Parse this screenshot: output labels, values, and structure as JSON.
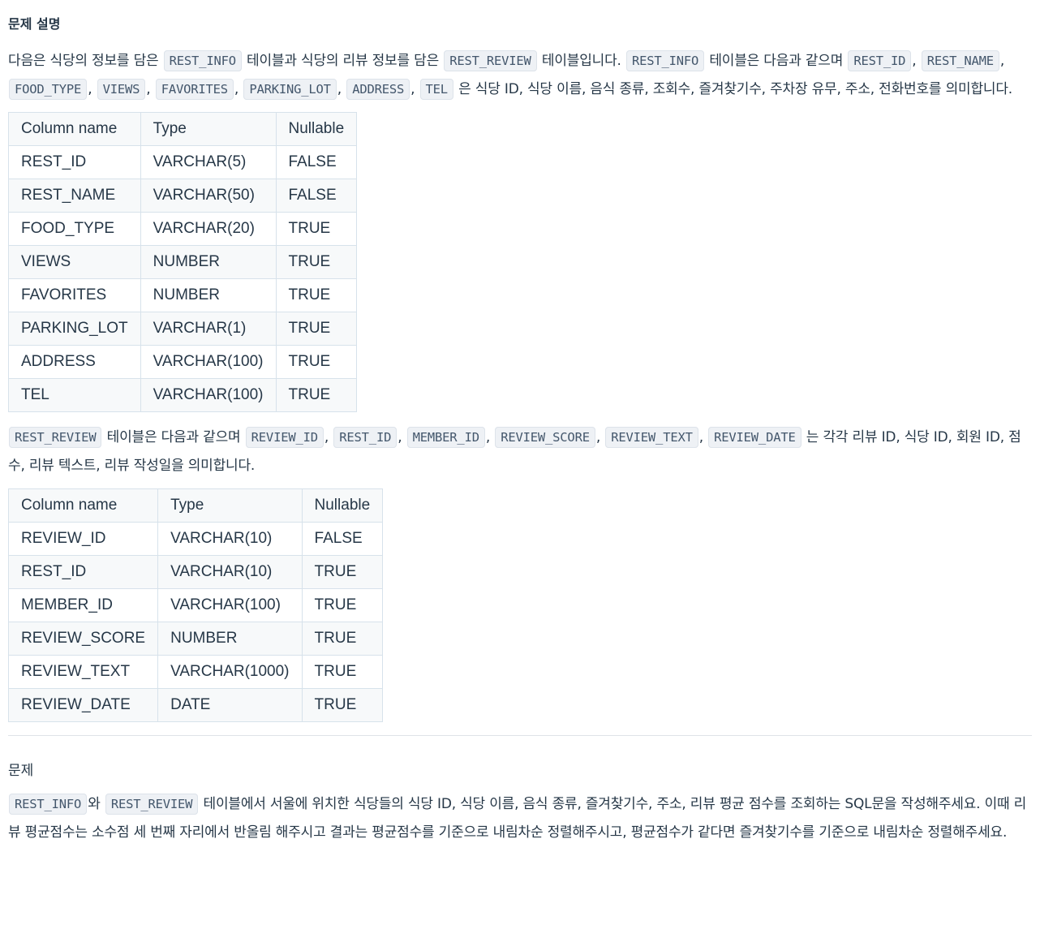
{
  "section_title": "문제 설명",
  "intro": {
    "t1": "다음은 식당의 정보를 담은 ",
    "c1": "REST_INFO",
    "t2": " 테이블과 식당의 리뷰 정보를 담은 ",
    "c2": "REST_REVIEW",
    "t3": " 테이블입니다. ",
    "c3": "REST_INFO",
    "t4": " 테이블은 다음과 같으며 ",
    "cols": [
      "REST_ID",
      "REST_NAME",
      "FOOD_TYPE",
      "VIEWS",
      "FAVORITES",
      "PARKING_LOT",
      "ADDRESS",
      "TEL"
    ],
    "t5": " 은 식당 ID, 식당 이름, 음식 종류, 조회수, 즐겨찾기수, 주차장 유무, 주소, 전화번호를 의미합니다."
  },
  "table1": {
    "headers": [
      "Column name",
      "Type",
      "Nullable"
    ],
    "rows": [
      [
        "REST_ID",
        "VARCHAR(5)",
        "FALSE"
      ],
      [
        "REST_NAME",
        "VARCHAR(50)",
        "FALSE"
      ],
      [
        "FOOD_TYPE",
        "VARCHAR(20)",
        "TRUE"
      ],
      [
        "VIEWS",
        "NUMBER",
        "TRUE"
      ],
      [
        "FAVORITES",
        "NUMBER",
        "TRUE"
      ],
      [
        "PARKING_LOT",
        "VARCHAR(1)",
        "TRUE"
      ],
      [
        "ADDRESS",
        "VARCHAR(100)",
        "TRUE"
      ],
      [
        "TEL",
        "VARCHAR(100)",
        "TRUE"
      ]
    ]
  },
  "review_intro": {
    "c1": "REST_REVIEW",
    "t1": " 테이블은 다음과 같으며 ",
    "cols": [
      "REVIEW_ID",
      "REST_ID",
      "MEMBER_ID",
      "REVIEW_SCORE",
      "REVIEW_TEXT",
      "REVIEW_DATE"
    ],
    "t2": " 는 각각 리뷰 ID, 식당 ID, 회원 ID, 점수, 리뷰 텍스트, 리뷰 작성일을 의미합니다."
  },
  "table2": {
    "headers": [
      "Column name",
      "Type",
      "Nullable"
    ],
    "rows": [
      [
        "REVIEW_ID",
        "VARCHAR(10)",
        "FALSE"
      ],
      [
        "REST_ID",
        "VARCHAR(10)",
        "TRUE"
      ],
      [
        "MEMBER_ID",
        "VARCHAR(100)",
        "TRUE"
      ],
      [
        "REVIEW_SCORE",
        "NUMBER",
        "TRUE"
      ],
      [
        "REVIEW_TEXT",
        "VARCHAR(1000)",
        "TRUE"
      ],
      [
        "REVIEW_DATE",
        "DATE",
        "TRUE"
      ]
    ]
  },
  "problem": {
    "label": "문제",
    "c1": "REST_INFO",
    "t1": "와 ",
    "c2": "REST_REVIEW",
    "t2": " 테이블에서 서울에 위치한 식당들의 식당 ID, 식당 이름, 음식 종류, 즐겨찾기수, 주소, 리뷰 평균 점수를 조회하는 SQL문을 작성해주세요. 이때 리뷰 평균점수는 소수점 세 번째 자리에서 반올림 해주시고 결과는 평균점수를 기준으로 내림차순 정렬해주시고, 평균점수가 같다면 즐겨찾기수를 기준으로 내림차순 정렬해주세요."
  }
}
